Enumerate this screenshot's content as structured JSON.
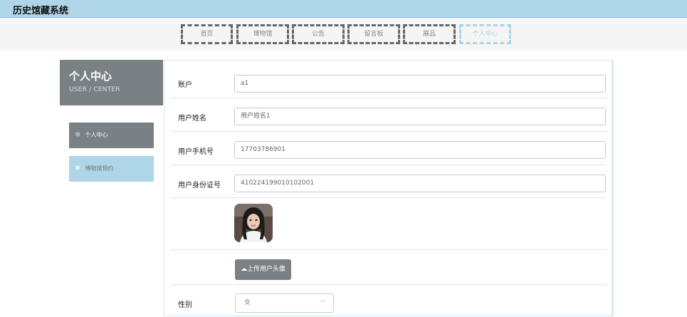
{
  "app": {
    "title": "历史馆藏系统"
  },
  "nav": {
    "items": [
      {
        "label": "首页"
      },
      {
        "label": "博物馆"
      },
      {
        "label": "公告"
      },
      {
        "label": "留言板"
      },
      {
        "label": "展品"
      },
      {
        "label": "个人中心",
        "active": true
      }
    ]
  },
  "sidebar": {
    "title": "个人中心",
    "subtitle": "USER / CENTER",
    "items": [
      {
        "label": "个人中心",
        "icon": "snowflake-icon",
        "active": true
      },
      {
        "label": "博物馆预约",
        "icon": "snowflake-icon",
        "active": false
      }
    ]
  },
  "form": {
    "account": {
      "label": "账户",
      "value": "a1"
    },
    "name": {
      "label": "用户姓名",
      "value": "用户姓名1"
    },
    "phone": {
      "label": "用户手机号",
      "value": "17703786901"
    },
    "idcard": {
      "label": "用户身份证号",
      "value": "410224199010102001"
    },
    "upload": {
      "label": "上传用户头像",
      "icon": "cloud-upload-icon"
    },
    "gender": {
      "label": "性别",
      "value": "女"
    }
  },
  "colors": {
    "topbar": "#aed6e8",
    "sidebar_active": "#7a8185",
    "sidebar_inactive": "#aed6e8",
    "nav_active": "#a8d5e8"
  }
}
